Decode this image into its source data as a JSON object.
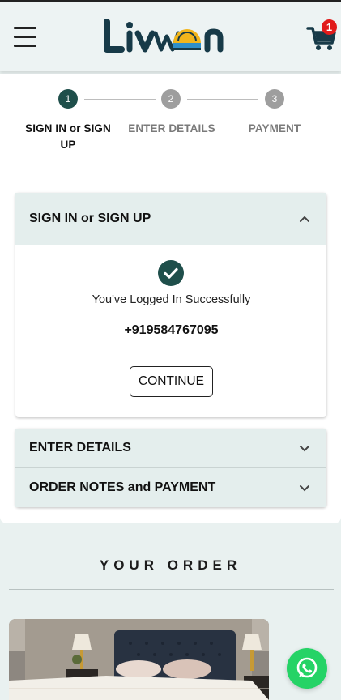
{
  "header": {
    "logo_text": "Livwon",
    "cart_count": "1"
  },
  "stepper": {
    "steps": [
      {
        "number": "1",
        "label": "SIGN IN or SIGN UP",
        "state": "active"
      },
      {
        "number": "2",
        "label": "ENTER DETAILS",
        "state": "inactive"
      },
      {
        "number": "3",
        "label": "PAYMENT",
        "state": "inactive"
      }
    ],
    "active_color": "#1f4f4b",
    "inactive_color": "#9e9e9e"
  },
  "signin": {
    "title": "SIGN IN or SIGN UP",
    "success_message": "You've Logged In Successfully",
    "phone": "+919584767095",
    "continue_label": "CONTINUE"
  },
  "sections": {
    "enter_details": "ENTER DETAILS",
    "order_notes_payment": "ORDER NOTES and PAYMENT"
  },
  "order": {
    "title": "YOUR ORDER"
  },
  "icons": {
    "menu": "hamburger-icon",
    "cart": "cart-icon",
    "check": "check-icon",
    "chevron_up": "chevron-up-icon",
    "chevron_down": "chevron-down-icon",
    "whatsapp": "whatsapp-icon"
  },
  "colors": {
    "brand_dark": "#1f4f4b",
    "header_bg": "#edf3f3",
    "accordion_bg": "#e4eeed",
    "badge": "#e11b1b",
    "whatsapp": "#25d366"
  }
}
